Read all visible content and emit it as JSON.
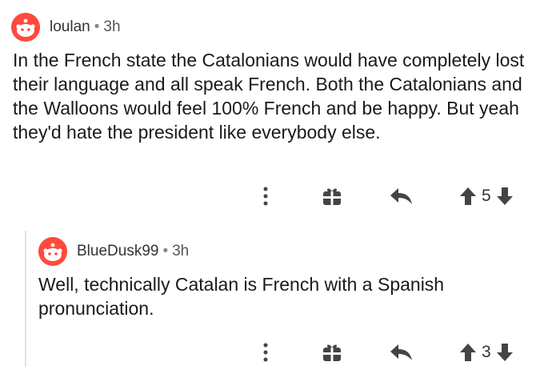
{
  "comments": [
    {
      "username": "loulan",
      "time": "3h",
      "separator": "•",
      "text": "In the French state the Catalonians would have completely lost their language and all speak French. Both the Catalonians and the Walloons would feel 100% French and be happy. But yeah they'd hate the president like everybody else.",
      "votes": "5"
    },
    {
      "username": "BlueDusk99",
      "time": "3h",
      "separator": "•",
      "text": "Well, technically Catalan is French with a Spanish pronunciation.",
      "votes": "3"
    }
  ],
  "colors": {
    "avatar": "#ff4a3d",
    "icons": "#444444"
  },
  "icons": [
    "more-icon",
    "award-icon",
    "reply-icon",
    "upvote-icon",
    "downvote-icon"
  ]
}
